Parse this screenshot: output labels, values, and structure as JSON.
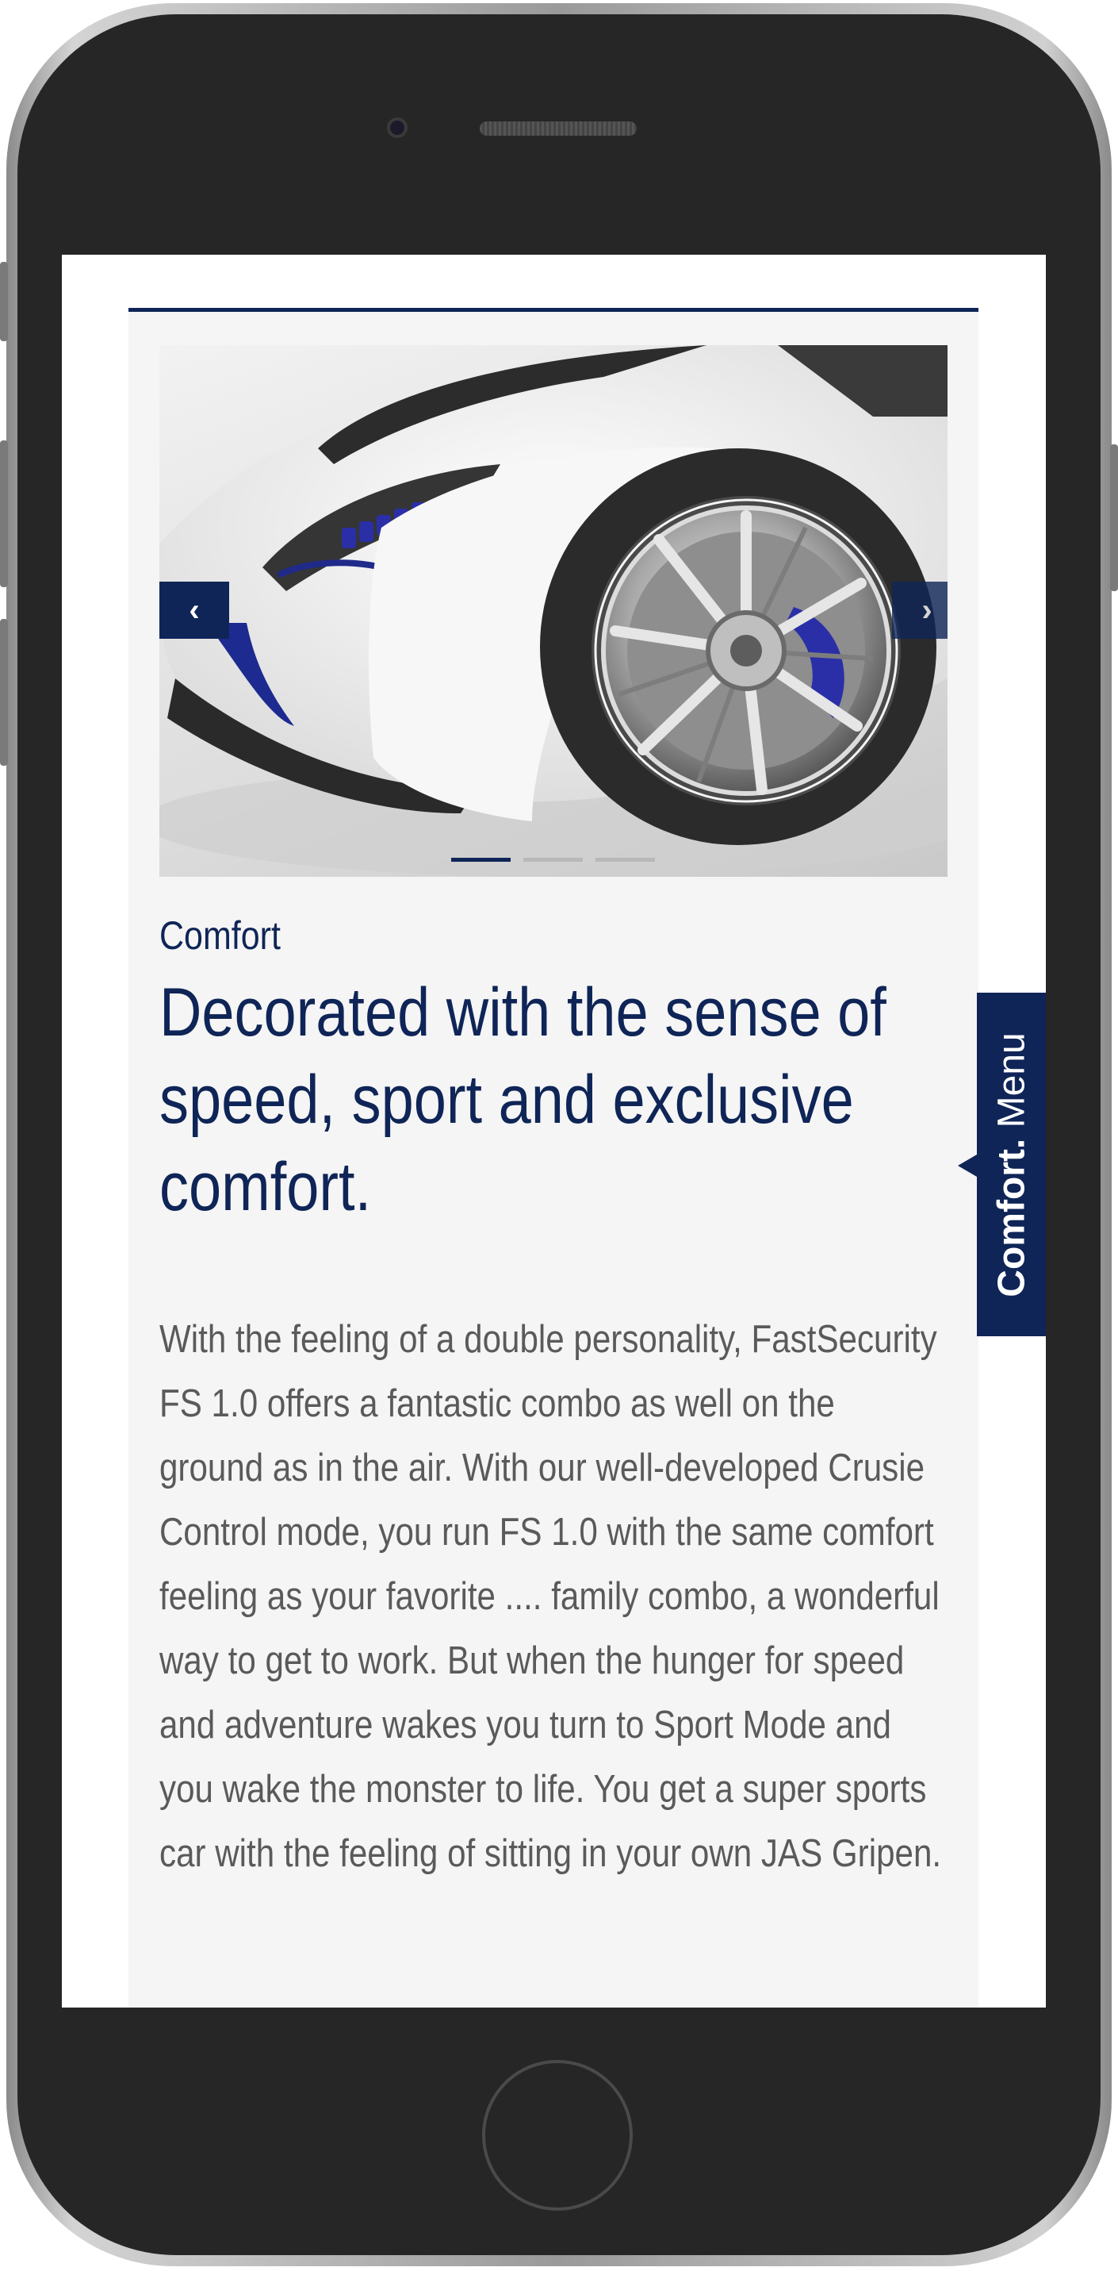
{
  "slider": {
    "prev_label": "‹",
    "next_label": "›",
    "slide_count": 3,
    "active_slide": 1
  },
  "content": {
    "kicker": "Comfort",
    "heading": "Decorated with the sense of speed, sport and exclusive comfort.",
    "body": "With the feeling of a double personality, FastSecurity FS 1.0 offers a fantastic combo as well on the ground as in the air. With our well-developed Crusie Control mode, you run FS 1.0 with the same comfort feeling as your favorite .... family combo, a wonderful way to get to work. But when the hunger for speed and adventure wakes you turn to Sport Mode and you wake the monster to life. You get a super sports car with the feeling of sitting in your own JAS Gripen."
  },
  "side_menu": {
    "bold_label": "Comfort.",
    "label": "Menu"
  },
  "colors": {
    "brand": "#0f2557",
    "panel_bg": "#f5f5f5",
    "body_text": "#5a5a5a"
  },
  "icons": {
    "prev": "chevron-left-icon",
    "next": "chevron-right-icon"
  }
}
